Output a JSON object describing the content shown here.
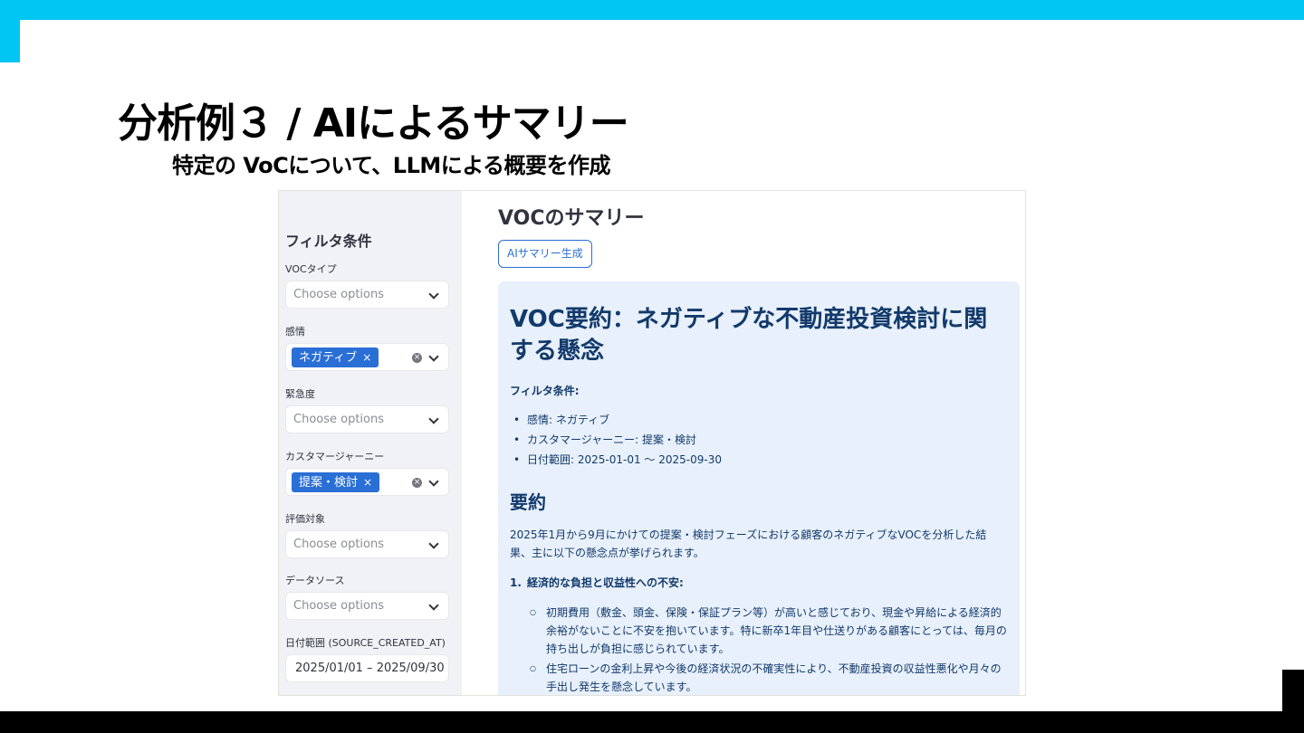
{
  "slide": {
    "title": "分析例３ / AIによるサマリー",
    "subtitle": "特定の VoCについて、LLMによる概要を作成",
    "accent_color": "#00c6f4"
  },
  "sidebar": {
    "heading": "フィルタ条件",
    "fields": [
      {
        "label": "VOCタイプ",
        "placeholder": "Choose options"
      },
      {
        "label": "感情",
        "tag": "ネガティブ",
        "tag_remove": "×",
        "clear": "×"
      },
      {
        "label": "緊急度",
        "placeholder": "Choose options"
      },
      {
        "label": "カスタマージャーニー",
        "tag": "提案・検討",
        "tag_remove": "×",
        "clear": "×"
      },
      {
        "label": "評価対象",
        "placeholder": "Choose options"
      },
      {
        "label": "データソース",
        "placeholder": "Choose options"
      },
      {
        "label": "日付範囲 (SOURCE_CREATED_AT)",
        "value": "2025/01/01 – 2025/09/30"
      }
    ],
    "tag_color": "#2a6fd6"
  },
  "main": {
    "title": "VOCのサマリー",
    "button_label": "AIサマリー生成"
  },
  "summary": {
    "title": "VOC要約：ネガティブな不動産投資検討に関する懸念",
    "filter_heading": "フィルタ条件:",
    "filters": [
      "感情: ネガティブ",
      "カスタマージャーニー: 提案・検討",
      "日付範囲: 2025-01-01 〜 2025-09-30"
    ],
    "section_title": "要約",
    "paragraph": "2025年1月から9月にかけての提案・検討フェーズにおける顧客のネガティブなVOCを分析した結果、主に以下の懸念点が挙げられます。",
    "concern_number": "1.",
    "concern_title": "経済的な負担と収益性への不安:",
    "concern_points": [
      "初期費用（敷金、頭金、保険・保証プラン等）が高いと感じており、現金や昇給による経済的余裕がないことに不安を抱いています。特に新卒1年目や仕送りがある顧客にとっては、毎月の持ち出しが負担に感じられています。",
      "住宅ローンの金利上昇や今後の経済状況の不確実性により、不動産投資の収益性悪化や月々の手出し発生を懸念しています。"
    ],
    "box_color": "#e8f0fb",
    "text_color": "#123a6b"
  }
}
